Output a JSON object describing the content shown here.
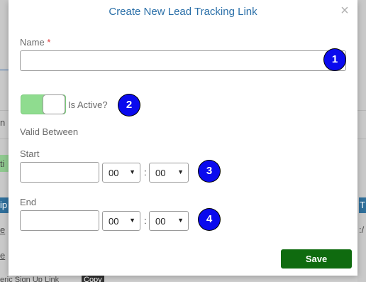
{
  "background": {
    "fragments": [
      "n",
      "ti",
      "ip",
      "e",
      "e",
      "T",
      ":/",
      "eric Sign Up Link"
    ],
    "copy_label": "Copy"
  },
  "modal": {
    "title": "Create New Lead Tracking Link",
    "close_glyph": "×",
    "name_label": "Name",
    "required_mark": "*",
    "name_value": "",
    "is_active_label": "Is Active?",
    "is_active": true,
    "valid_between_label": "Valid Between",
    "start_label": "Start",
    "start_date": "",
    "start_hour": "00",
    "start_minute": "00",
    "end_label": "End",
    "end_date": "",
    "end_hour": "00",
    "end_minute": "00",
    "time_separator": ":",
    "save_label": "Save",
    "badges": [
      "1",
      "2",
      "3",
      "4"
    ]
  },
  "colors": {
    "title": "#2a6fa8",
    "toggle_on": "#8fdc8f",
    "save": "#0f6b0f",
    "badge": "#0a0aee",
    "required": "#e03a3a"
  }
}
